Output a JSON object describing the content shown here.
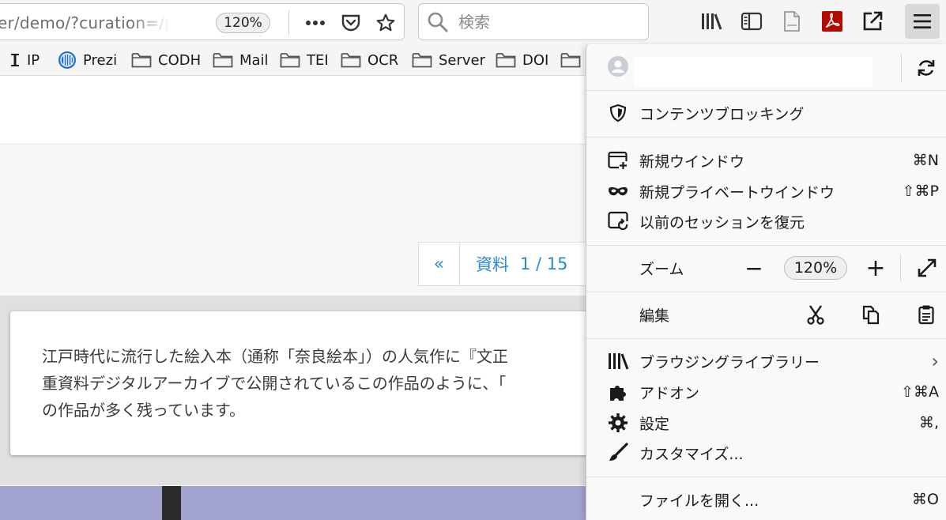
{
  "toolbar": {
    "url_text": "er/demo/?curation=/p",
    "zoom": "120%",
    "search_placeholder": "検索"
  },
  "bookmarks": [
    {
      "label": "IP",
      "icon": "text-cursor-icon"
    },
    {
      "label": "Prezi",
      "icon": "prezi-icon"
    },
    {
      "label": "CODH",
      "icon": "folder-icon"
    },
    {
      "label": "Mail",
      "icon": "folder-icon"
    },
    {
      "label": "TEI",
      "icon": "folder-icon"
    },
    {
      "label": "OCR",
      "icon": "folder-icon"
    },
    {
      "label": "Server",
      "icon": "folder-icon"
    },
    {
      "label": "DOI",
      "icon": "folder-icon"
    }
  ],
  "page": {
    "pager_prev": "«",
    "pager_label": "資料",
    "pager_count": "1 / 15",
    "card_text": "江戸時代に流行した絵入本（通称「奈良絵本」）の人気作に『文正\n重資料デジタルアーカイブで公開されているこの作品のように、「\nの作品が多く残っています。"
  },
  "menu": {
    "content_blocking": "コンテンツブロッキング",
    "new_window": {
      "label": "新規ウインドウ",
      "shortcut": "⌘N"
    },
    "private_window": {
      "label": "新規プライベートウインドウ",
      "shortcut": "⇧⌘P"
    },
    "restore_session": {
      "label": "以前のセッションを復元"
    },
    "zoom": {
      "label": "ズーム",
      "minus": "−",
      "value": "120%",
      "plus": "+"
    },
    "edit": {
      "label": "編集"
    },
    "library": {
      "label": "ブラウジングライブラリー",
      "chevron": "›"
    },
    "addons": {
      "label": "アドオン",
      "shortcut": "⇧⌘A"
    },
    "settings": {
      "label": "設定",
      "shortcut": "⌘,"
    },
    "customize": {
      "label": "カスタマイズ..."
    },
    "open_file": {
      "label": "ファイルを開く...",
      "shortcut": "⌘O"
    }
  },
  "colors": {
    "link_blue": "#2a8ad0",
    "image_strip": "#a3a3cf"
  }
}
